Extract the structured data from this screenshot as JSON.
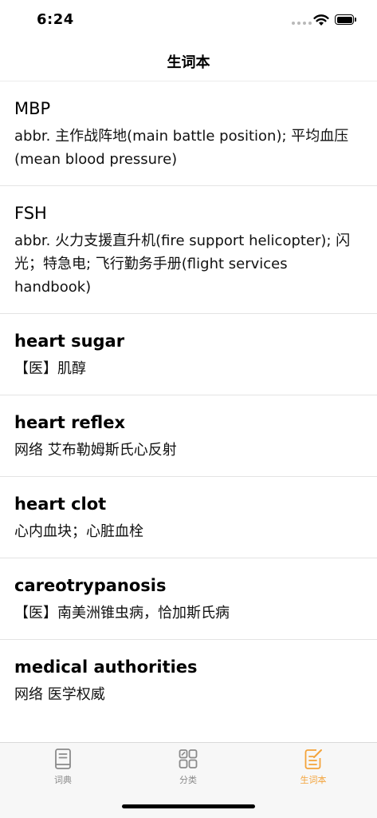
{
  "status_bar": {
    "time": "6:24"
  },
  "nav": {
    "title": "生词本"
  },
  "entries": [
    {
      "word": "MBP",
      "definition": "abbr.  主作战阵地(main battle position); 平均血压(mean blood pressure)"
    },
    {
      "word": "FSH",
      "definition": "abbr.  火力支援直升机(fire support helicopter); 闪光；特急电; 飞行勤务手册(flight services handbook)"
    },
    {
      "word": "heart sugar",
      "definition": "【医】肌醇"
    },
    {
      "word": "heart reflex",
      "definition": "网络  艾布勒姆斯氏心反射"
    },
    {
      "word": "heart clot",
      "definition": "心内血块；心脏血栓"
    },
    {
      "word": "careotrypanosis",
      "definition": "【医】南美洲锥虫病，恰加斯氏病"
    },
    {
      "word": "medical authorities",
      "definition": "网络  医学权威"
    }
  ],
  "tab_bar": {
    "tabs": [
      {
        "label": "词典",
        "icon": "dictionary-book-icon",
        "active": false
      },
      {
        "label": "分类",
        "icon": "category-grid-icon",
        "active": false
      },
      {
        "label": "生词本",
        "icon": "notebook-edit-icon",
        "active": true
      }
    ]
  },
  "colors": {
    "accent": "#f3a33a",
    "inactive": "#8a8a8a",
    "divider": "#e4e4e4",
    "tab_bar_bg": "#f7f7f7"
  }
}
